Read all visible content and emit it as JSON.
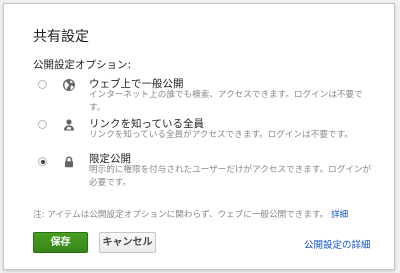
{
  "dialog": {
    "title": "共有設定",
    "section_label": "公開設定オプション:",
    "options": [
      {
        "title": "ウェブ上で一般公開",
        "description": "インターネット上の誰でも検索、アクセスできます。ログインは不要です。",
        "icon": "globe-icon",
        "selected": false
      },
      {
        "title": "リンクを知っている全員",
        "description": "リンクを知っている全員がアクセスできます。ログインは不要です。",
        "icon": "person-icon",
        "selected": false
      },
      {
        "title": "限定公開",
        "description": "明示的に権限を付与されたユーザーだけがアクセスできます。ログインが必要です。",
        "icon": "lock-icon",
        "selected": true
      }
    ],
    "note": "注: アイテムは公開設定オプションに関わらず、ウェブに一般公開できます。",
    "note_link": "詳細",
    "save_label": "保存",
    "cancel_label": "キャンセル",
    "details_link": "公開設定の詳細"
  },
  "colors": {
    "save_button": "#3d8b1c",
    "link": "#1155cc",
    "description_text": "#888888"
  }
}
